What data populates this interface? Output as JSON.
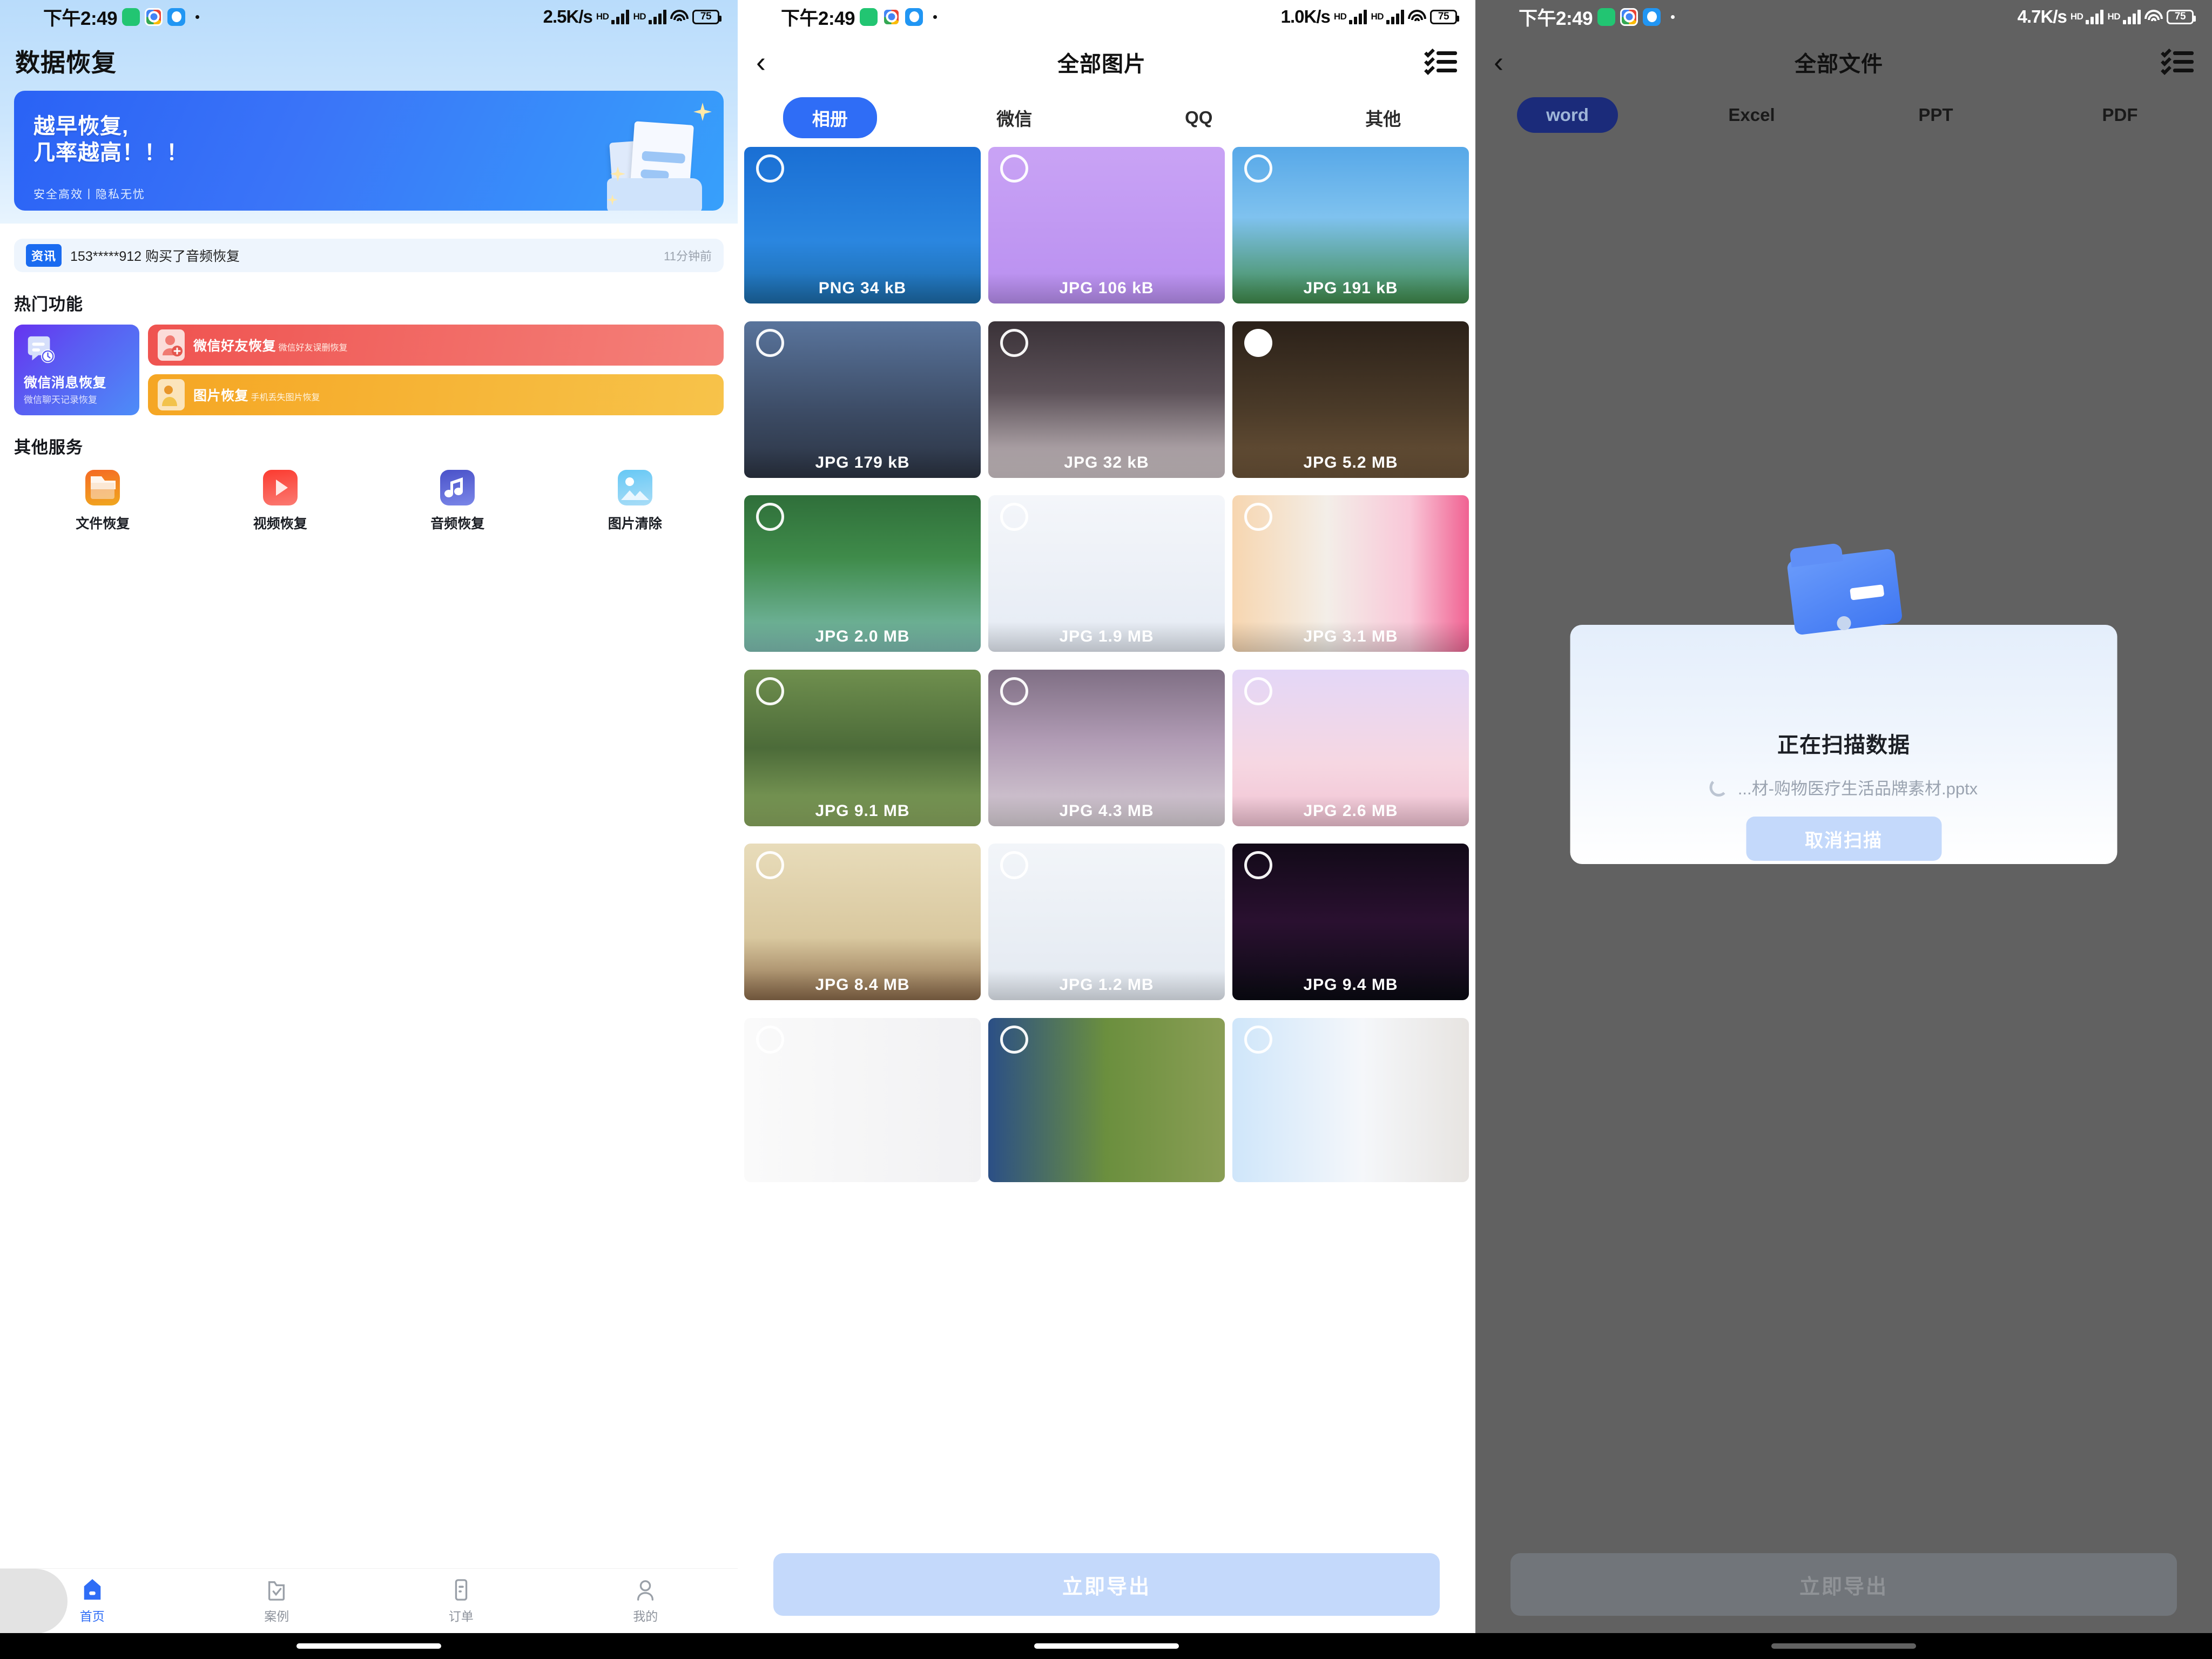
{
  "panel1": {
    "status": {
      "time": "下午2:49",
      "net_speed": "2.5K/s",
      "hd": "HD",
      "battery": "75"
    },
    "title": "数据恢复",
    "banner": {
      "line1": "越早恢复,",
      "line2": "几率越高！！！",
      "sub": "安全高效丨隐私无忧"
    },
    "news": {
      "badge": "资讯",
      "text": "153*****912 购买了音频恢复",
      "time": "11分钟前"
    },
    "hot_section_title": "热门功能",
    "hot": {
      "big": {
        "title": "微信消息恢复",
        "sub": "微信聊天记录恢复",
        "icon": "chat-clock-icon"
      },
      "small": [
        {
          "title": "微信好友恢复",
          "sub": "微信好友误删恢复",
          "icon": "contact-add-icon"
        },
        {
          "title": "图片恢复",
          "sub": "手机丢失图片恢复",
          "icon": "photo-person-icon"
        }
      ]
    },
    "other_section_title": "其他服务",
    "services": [
      {
        "label": "文件恢复",
        "icon": "folder-icon"
      },
      {
        "label": "视频恢复",
        "icon": "play-icon"
      },
      {
        "label": "音频恢复",
        "icon": "music-note-icon"
      },
      {
        "label": "图片清除",
        "icon": "image-icon"
      }
    ],
    "tabs": [
      {
        "label": "首页",
        "icon": "home-icon",
        "active": true
      },
      {
        "label": "案例",
        "icon": "folder-check-icon",
        "active": false
      },
      {
        "label": "订单",
        "icon": "order-list-icon",
        "active": false
      },
      {
        "label": "我的",
        "icon": "person-icon",
        "active": false
      }
    ]
  },
  "panel2": {
    "status": {
      "time": "下午2:49",
      "net_speed": "1.0K/s",
      "hd": "HD",
      "battery": "75"
    },
    "nav": {
      "back_icon": "chevron-left-icon",
      "title": "全部图片",
      "select_all_icon": "checklist-icon"
    },
    "chips": [
      {
        "label": "相册",
        "selected": true
      },
      {
        "label": "微信",
        "selected": false
      },
      {
        "label": "QQ",
        "selected": false
      },
      {
        "label": "其他",
        "selected": false
      }
    ],
    "grid": [
      {
        "meta": "PNG 34 kB",
        "selected": false,
        "thumb": "t-mc-apple"
      },
      {
        "meta": "JPG 106 kB",
        "selected": false,
        "thumb": "t-anime-pink"
      },
      {
        "meta": "JPG 191 kB",
        "selected": false,
        "thumb": "t-mc-build"
      },
      {
        "meta": "JPG 179 kB",
        "selected": false,
        "thumb": "t-mc-dark"
      },
      {
        "meta": "JPG 32 kB",
        "selected": false,
        "thumb": "t-dress"
      },
      {
        "meta": "JPG 5.2 MB",
        "selected": true,
        "thumb": "t-dark-room"
      },
      {
        "meta": "JPG 2.0 MB",
        "selected": false,
        "thumb": "t-game-forest"
      },
      {
        "meta": "JPG 1.9 MB",
        "selected": false,
        "thumb": "t-appshot"
      },
      {
        "meta": "JPG 3.1 MB",
        "selected": false,
        "thumb": "t-collage"
      },
      {
        "meta": "JPG 9.1 MB",
        "selected": false,
        "thumb": "t-war"
      },
      {
        "meta": "JPG 4.3 MB",
        "selected": false,
        "thumb": "t-anime2"
      },
      {
        "meta": "JPG 2.6 MB",
        "selected": false,
        "thumb": "t-cute"
      },
      {
        "meta": "JPG 8.4 MB",
        "selected": false,
        "thumb": "t-sand"
      },
      {
        "meta": "JPG 1.2 MB",
        "selected": false,
        "thumb": "t-battery"
      },
      {
        "meta": "JPG 9.4 MB",
        "selected": false,
        "thumb": "t-space"
      },
      {
        "meta": "",
        "selected": false,
        "thumb": "t-books"
      },
      {
        "meta": "",
        "selected": false,
        "thumb": "t-jp-game"
      },
      {
        "meta": "",
        "selected": false,
        "thumb": "t-store"
      }
    ],
    "export_label": "立即导出"
  },
  "panel3": {
    "status": {
      "time": "下午2:49",
      "net_speed": "4.7K/s",
      "hd": "HD",
      "battery": "75"
    },
    "nav": {
      "back_icon": "chevron-left-icon",
      "title": "全部文件",
      "select_all_icon": "checklist-icon"
    },
    "chips": [
      {
        "label": "word",
        "selected": true
      },
      {
        "label": "Excel",
        "selected": false
      },
      {
        "label": "PPT",
        "selected": false
      },
      {
        "label": "PDF",
        "selected": false
      }
    ],
    "dialog": {
      "icon": "folder-icon",
      "title": "正在扫描数据",
      "spinner_icon": "loading-spinner-icon",
      "filename": "...材-购物医疗生活品牌素材.pptx",
      "cancel_label": "取消扫描"
    },
    "export_label": "立即导出"
  },
  "colors": {
    "accent_blue": "#2f6df6",
    "banner_blue": "#2a62f5",
    "banner_cyan": "#37a0fb",
    "purple": "#6633f0",
    "red": "#ef5350",
    "orange": "#f5a623",
    "muted_blue_btn": "#c4d9fb",
    "status_bar_bg": "#b9dcfb"
  }
}
